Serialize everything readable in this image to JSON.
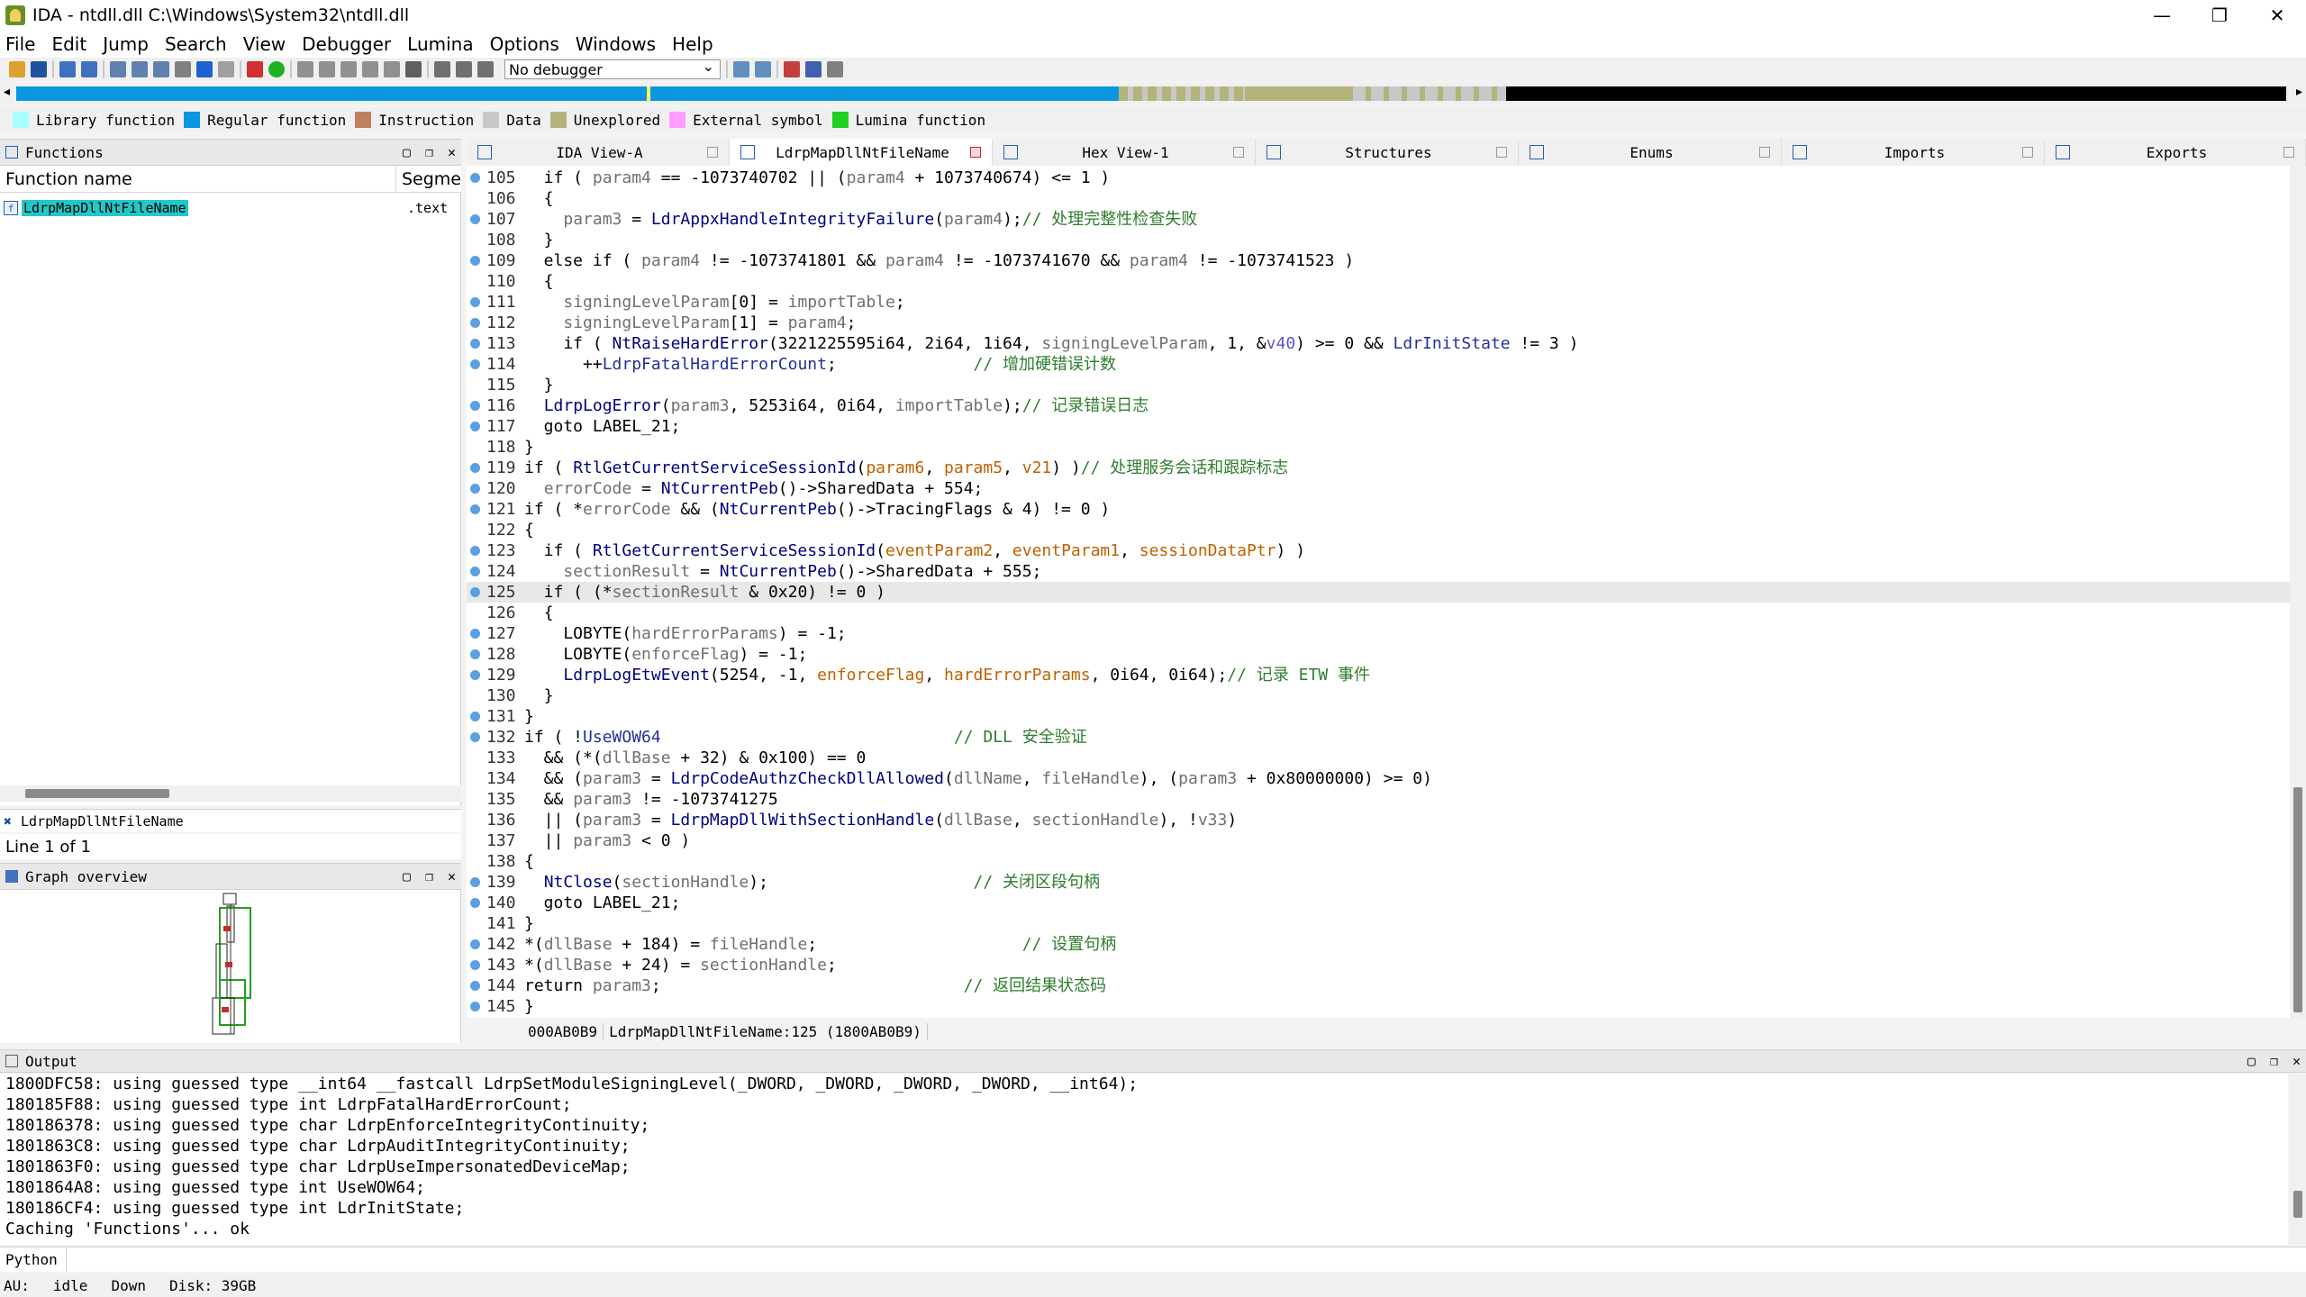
{
  "window": {
    "title": "IDA - ntdll.dll C:\\Windows\\System32\\ntdll.dll",
    "minimize": "—",
    "maximize": "❐",
    "close": "✕"
  },
  "menu": [
    "File",
    "Edit",
    "Jump",
    "Search",
    "View",
    "Debugger",
    "Lumina",
    "Options",
    "Windows",
    "Help"
  ],
  "toolbar": {
    "debugger_select": "No debugger"
  },
  "legend": [
    {
      "label": "Library function",
      "color": "#aaffff"
    },
    {
      "label": "Regular function",
      "color": "#0a96e0"
    },
    {
      "label": "Instruction",
      "color": "#c08060"
    },
    {
      "label": "Data",
      "color": "#c8c8c8"
    },
    {
      "label": "Unexplored",
      "color": "#b4b47a"
    },
    {
      "label": "External symbol",
      "color": "#ff9cff"
    },
    {
      "label": "Lumina function",
      "color": "#20d020"
    }
  ],
  "functions_panel": {
    "title": "Functions",
    "col_name": "Function name",
    "col_segment": "Segme",
    "rows": [
      {
        "name": "LdrpMapDllNtFileName",
        "segment": ".text"
      }
    ],
    "filter_text": "LdrpMapDllNtFileName",
    "line_info": "Line 1 of 1"
  },
  "graph_panel": {
    "title": "Graph overview"
  },
  "tabs": [
    {
      "label": "IDA View-A",
      "active": false
    },
    {
      "label": "LdrpMapDllNtFileName",
      "active": true
    },
    {
      "label": "Hex View-1",
      "active": false
    },
    {
      "label": "Structures",
      "active": false
    },
    {
      "label": "Enums",
      "active": false
    },
    {
      "label": "Imports",
      "active": false
    },
    {
      "label": "Exports",
      "active": false
    }
  ],
  "code_lines": [
    {
      "n": "105",
      "bp": true,
      "hl": false,
      "t": [
        [
          "  if ( ",
          ""
        ],
        [
          "param4",
          "v"
        ],
        [
          " == -1073740702 || (",
          ""
        ],
        [
          "param4",
          "v"
        ],
        [
          " + 1073740674) <= 1 )",
          ""
        ]
      ]
    },
    {
      "n": "106",
      "bp": false,
      "hl": false,
      "t": [
        [
          "  {",
          ""
        ]
      ]
    },
    {
      "n": "107",
      "bp": true,
      "hl": false,
      "t": [
        [
          "    ",
          ""
        ],
        [
          "param3",
          "v"
        ],
        [
          " = ",
          ""
        ],
        [
          "LdrAppxHandleIntegrityFailure",
          "n"
        ],
        [
          "(",
          ""
        ],
        [
          "param4",
          "v"
        ],
        [
          ");",
          ""
        ],
        [
          "// 处理完整性检查失败",
          "c"
        ]
      ]
    },
    {
      "n": "108",
      "bp": false,
      "hl": false,
      "t": [
        [
          "  }",
          ""
        ]
      ]
    },
    {
      "n": "109",
      "bp": true,
      "hl": false,
      "t": [
        [
          "  else if ( ",
          ""
        ],
        [
          "param4",
          "v"
        ],
        [
          " != -1073741801 && ",
          ""
        ],
        [
          "param4",
          "v"
        ],
        [
          " != -1073741670 && ",
          ""
        ],
        [
          "param4",
          "v"
        ],
        [
          " != -1073741523 )",
          ""
        ]
      ]
    },
    {
      "n": "110",
      "bp": false,
      "hl": false,
      "t": [
        [
          "  {",
          ""
        ]
      ]
    },
    {
      "n": "111",
      "bp": true,
      "hl": false,
      "t": [
        [
          "    ",
          ""
        ],
        [
          "signingLevelParam",
          "v"
        ],
        [
          "[0] = ",
          ""
        ],
        [
          "importTable",
          "v"
        ],
        [
          ";",
          ""
        ]
      ]
    },
    {
      "n": "112",
      "bp": true,
      "hl": false,
      "t": [
        [
          "    ",
          ""
        ],
        [
          "signingLevelParam",
          "v"
        ],
        [
          "[1] = ",
          ""
        ],
        [
          "param4",
          "v"
        ],
        [
          ";",
          ""
        ]
      ]
    },
    {
      "n": "113",
      "bp": true,
      "hl": false,
      "t": [
        [
          "    if ( ",
          ""
        ],
        [
          "NtRaiseHardError",
          "n"
        ],
        [
          "(3221225595i64, 2i64, 1i64, ",
          ""
        ],
        [
          "signingLevelParam",
          "v"
        ],
        [
          ", 1, &",
          ""
        ],
        [
          "v40",
          "ptr"
        ],
        [
          ") >= 0 && ",
          ""
        ],
        [
          "LdrInitState",
          "g"
        ],
        [
          " != 3 )",
          ""
        ]
      ]
    },
    {
      "n": "114",
      "bp": true,
      "hl": false,
      "t": [
        [
          "      ++",
          ""
        ],
        [
          "LdrpFatalHardErrorCount",
          "g"
        ],
        [
          ";              ",
          ""
        ],
        [
          "// 增加硬错误计数",
          "c"
        ]
      ]
    },
    {
      "n": "115",
      "bp": false,
      "hl": false,
      "t": [
        [
          "  }",
          ""
        ]
      ]
    },
    {
      "n": "116",
      "bp": true,
      "hl": false,
      "t": [
        [
          "  ",
          ""
        ],
        [
          "LdrpLogError",
          "n"
        ],
        [
          "(",
          ""
        ],
        [
          "param3",
          "v"
        ],
        [
          ", 5253i64, 0i64, ",
          ""
        ],
        [
          "importTable",
          "v"
        ],
        [
          ");",
          ""
        ],
        [
          "// 记录错误日志",
          "c"
        ]
      ]
    },
    {
      "n": "117",
      "bp": true,
      "hl": false,
      "t": [
        [
          "  goto LABEL_21;",
          ""
        ]
      ]
    },
    {
      "n": "118",
      "bp": false,
      "hl": false,
      "t": [
        [
          "}",
          ""
        ]
      ]
    },
    {
      "n": "119",
      "bp": true,
      "hl": false,
      "t": [
        [
          "if ( ",
          ""
        ],
        [
          "RtlGetCurrentServiceSessionId",
          "n"
        ],
        [
          "(",
          ""
        ],
        [
          "param6",
          "p"
        ],
        [
          ", ",
          ""
        ],
        [
          "param5",
          "p"
        ],
        [
          ", ",
          ""
        ],
        [
          "v21",
          "p"
        ],
        [
          ") )",
          ""
        ],
        [
          "// 处理服务会话和跟踪标志",
          "c"
        ]
      ]
    },
    {
      "n": "120",
      "bp": true,
      "hl": false,
      "t": [
        [
          "  ",
          ""
        ],
        [
          "errorCode",
          "v"
        ],
        [
          " = ",
          ""
        ],
        [
          "NtCurrentPeb",
          "n"
        ],
        [
          "()->SharedData + 554;",
          ""
        ]
      ]
    },
    {
      "n": "121",
      "bp": true,
      "hl": false,
      "t": [
        [
          "if ( *",
          ""
        ],
        [
          "errorCode",
          "v"
        ],
        [
          " && (",
          ""
        ],
        [
          "NtCurrentPeb",
          "n"
        ],
        [
          "()->TracingFlags & 4) != 0 )",
          ""
        ]
      ]
    },
    {
      "n": "122",
      "bp": false,
      "hl": false,
      "t": [
        [
          "{",
          ""
        ]
      ]
    },
    {
      "n": "123",
      "bp": true,
      "hl": false,
      "t": [
        [
          "  if ( ",
          ""
        ],
        [
          "RtlGetCurrentServiceSessionId",
          "n"
        ],
        [
          "(",
          ""
        ],
        [
          "eventParam2",
          "p"
        ],
        [
          ", ",
          ""
        ],
        [
          "eventParam1",
          "p"
        ],
        [
          ", ",
          ""
        ],
        [
          "sessionDataPtr",
          "p"
        ],
        [
          ") )",
          ""
        ]
      ]
    },
    {
      "n": "124",
      "bp": true,
      "hl": false,
      "t": [
        [
          "    ",
          ""
        ],
        [
          "sectionResult",
          "v"
        ],
        [
          " = ",
          ""
        ],
        [
          "NtCurrentPeb",
          "n"
        ],
        [
          "()->SharedData + 555;",
          ""
        ]
      ]
    },
    {
      "n": "125",
      "bp": true,
      "hl": true,
      "t": [
        [
          "  if ( (*",
          ""
        ],
        [
          "sectionResult",
          "v"
        ],
        [
          " & 0x20) != 0 )",
          ""
        ]
      ]
    },
    {
      "n": "126",
      "bp": false,
      "hl": false,
      "t": [
        [
          "  {",
          ""
        ]
      ]
    },
    {
      "n": "127",
      "bp": true,
      "hl": false,
      "t": [
        [
          "    LOBYTE(",
          ""
        ],
        [
          "hardErrorParams",
          "v"
        ],
        [
          ") = -1;",
          ""
        ]
      ]
    },
    {
      "n": "128",
      "bp": true,
      "hl": false,
      "t": [
        [
          "    LOBYTE(",
          ""
        ],
        [
          "enforceFlag",
          "v"
        ],
        [
          ") = -1;",
          ""
        ]
      ]
    },
    {
      "n": "129",
      "bp": true,
      "hl": false,
      "t": [
        [
          "    ",
          ""
        ],
        [
          "LdrpLogEtwEvent",
          "n"
        ],
        [
          "(5254, -1, ",
          ""
        ],
        [
          "enforceFlag",
          "p"
        ],
        [
          ", ",
          ""
        ],
        [
          "hardErrorParams",
          "p"
        ],
        [
          ", 0i64, 0i64);",
          ""
        ],
        [
          "// 记录 ETW 事件",
          "c"
        ]
      ]
    },
    {
      "n": "130",
      "bp": false,
      "hl": false,
      "t": [
        [
          "  }",
          ""
        ]
      ]
    },
    {
      "n": "131",
      "bp": true,
      "hl": false,
      "t": [
        [
          "}",
          ""
        ]
      ]
    },
    {
      "n": "132",
      "bp": true,
      "hl": false,
      "t": [
        [
          "if ( !",
          ""
        ],
        [
          "UseWOW64",
          "g"
        ],
        [
          "                              ",
          ""
        ],
        [
          "// DLL 安全验证",
          "c"
        ]
      ]
    },
    {
      "n": "133",
      "bp": false,
      "hl": false,
      "t": [
        [
          "  && (*(",
          ""
        ],
        [
          "dllBase",
          "v"
        ],
        [
          " + 32) & 0x100) == 0",
          ""
        ]
      ]
    },
    {
      "n": "134",
      "bp": false,
      "hl": false,
      "t": [
        [
          "  && (",
          ""
        ],
        [
          "param3",
          "v"
        ],
        [
          " = ",
          ""
        ],
        [
          "LdrpCodeAuthzCheckDllAllowed",
          "n"
        ],
        [
          "(",
          ""
        ],
        [
          "dllName",
          "v"
        ],
        [
          ", ",
          ""
        ],
        [
          "fileHandle",
          "v"
        ],
        [
          "), (",
          ""
        ],
        [
          "param3",
          "v"
        ],
        [
          " + 0x80000000) >= 0)",
          ""
        ]
      ]
    },
    {
      "n": "135",
      "bp": false,
      "hl": false,
      "t": [
        [
          "  && ",
          ""
        ],
        [
          "param3",
          "v"
        ],
        [
          " != -1073741275",
          ""
        ]
      ]
    },
    {
      "n": "136",
      "bp": false,
      "hl": false,
      "t": [
        [
          "  || (",
          ""
        ],
        [
          "param3",
          "v"
        ],
        [
          " = ",
          ""
        ],
        [
          "LdrpMapDllWithSectionHandle",
          "n"
        ],
        [
          "(",
          ""
        ],
        [
          "dllBase",
          "v"
        ],
        [
          ", ",
          ""
        ],
        [
          "sectionHandle",
          "v"
        ],
        [
          "), !",
          ""
        ],
        [
          "v33",
          "v"
        ],
        [
          ")",
          ""
        ]
      ]
    },
    {
      "n": "137",
      "bp": false,
      "hl": false,
      "t": [
        [
          "  || ",
          ""
        ],
        [
          "param3",
          "v"
        ],
        [
          " < 0 )",
          ""
        ]
      ]
    },
    {
      "n": "138",
      "bp": false,
      "hl": false,
      "t": [
        [
          "{",
          ""
        ]
      ]
    },
    {
      "n": "139",
      "bp": true,
      "hl": false,
      "t": [
        [
          "  ",
          ""
        ],
        [
          "NtClose",
          "n"
        ],
        [
          "(",
          ""
        ],
        [
          "sectionHandle",
          "v"
        ],
        [
          ");                     ",
          ""
        ],
        [
          "// 关闭区段句柄",
          "c"
        ]
      ]
    },
    {
      "n": "140",
      "bp": true,
      "hl": false,
      "t": [
        [
          "  goto LABEL_21;",
          ""
        ]
      ]
    },
    {
      "n": "141",
      "bp": false,
      "hl": false,
      "t": [
        [
          "}",
          ""
        ]
      ]
    },
    {
      "n": "142",
      "bp": true,
      "hl": false,
      "t": [
        [
          "*(",
          ""
        ],
        [
          "dllBase",
          "v"
        ],
        [
          " + 184) = ",
          ""
        ],
        [
          "fileHandle",
          "v"
        ],
        [
          ";                     ",
          ""
        ],
        [
          "// 设置句柄",
          "c"
        ]
      ]
    },
    {
      "n": "143",
      "bp": true,
      "hl": false,
      "t": [
        [
          "*(",
          ""
        ],
        [
          "dllBase",
          "v"
        ],
        [
          " + 24) = ",
          ""
        ],
        [
          "sectionHandle",
          "v"
        ],
        [
          ";",
          ""
        ]
      ]
    },
    {
      "n": "144",
      "bp": true,
      "hl": false,
      "t": [
        [
          "return ",
          ""
        ],
        [
          "param3",
          "v"
        ],
        [
          ";                               ",
          ""
        ],
        [
          "// 返回结果状态码",
          "c"
        ]
      ]
    },
    {
      "n": "145",
      "bp": true,
      "hl": false,
      "t": [
        [
          "}",
          ""
        ]
      ]
    }
  ],
  "editor_status": {
    "address": "000AB0B9",
    "location": "LdrpMapDllNtFileName:125 (1800AB0B9)"
  },
  "output": {
    "title": "Output",
    "lines": [
      "1800DFC58: using guessed type __int64 __fastcall LdrpSetModuleSigningLevel(_DWORD, _DWORD, _DWORD, _DWORD, __int64);",
      "180185F88: using guessed type int LdrpFatalHardErrorCount;",
      "180186378: using guessed type char LdrpEnforceIntegrityContinuity;",
      "1801863C8: using guessed type char LdrpAuditIntegrityContinuity;",
      "1801863F0: using guessed type char LdrpUseImpersonatedDeviceMap;",
      "1801864A8: using guessed type int UseWOW64;",
      "180186CF4: using guessed type int LdrInitState;",
      "Caching 'Functions'... ok"
    ]
  },
  "python_bar": {
    "label": "Python"
  },
  "statusbar": {
    "au": "AU:",
    "state": "idle",
    "direction": "Down",
    "disk": "Disk: 39GB"
  }
}
